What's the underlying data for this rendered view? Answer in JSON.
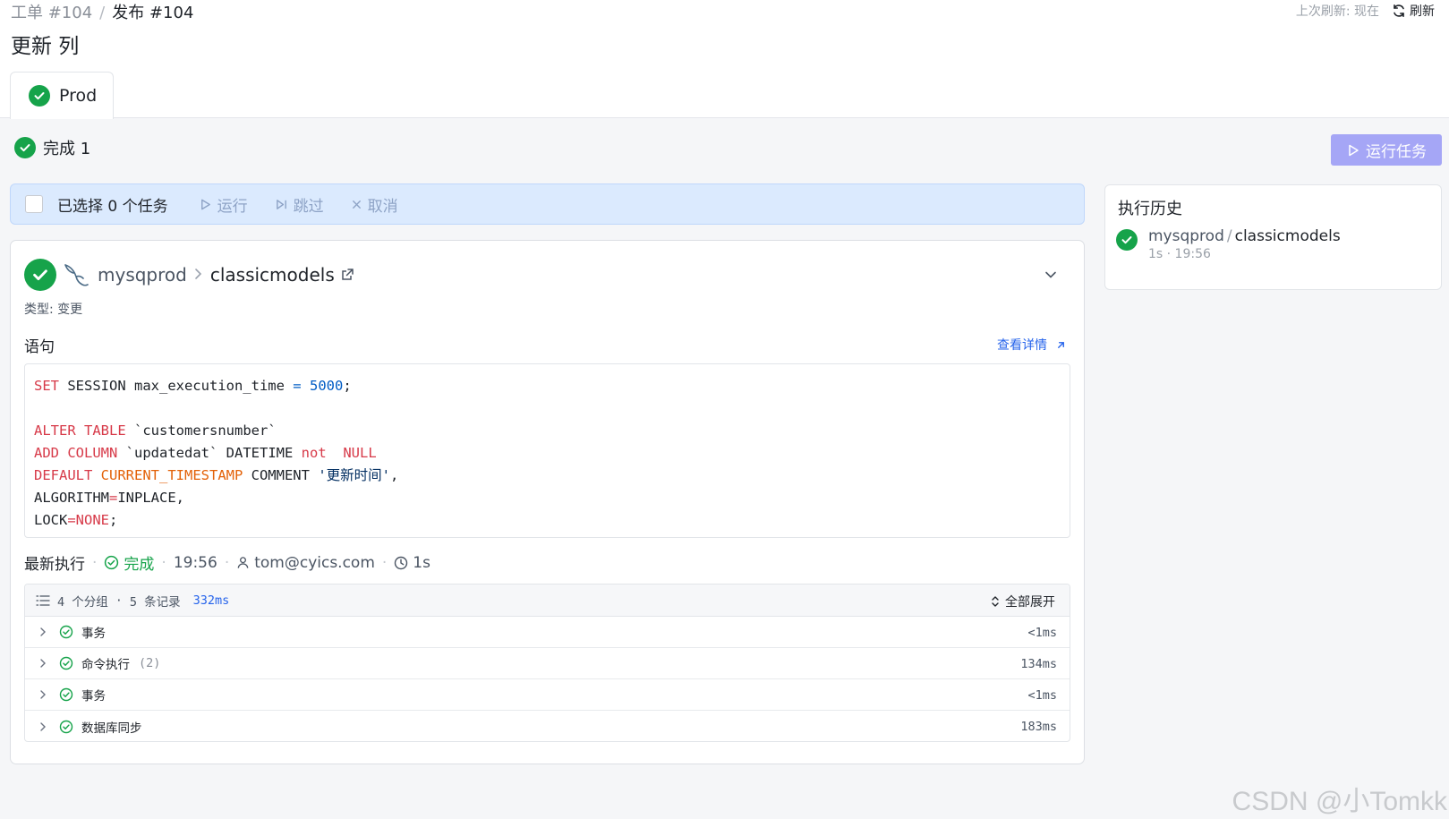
{
  "breadcrumb": {
    "ticket": "工单 #104",
    "separator": "/",
    "release": "发布 #104"
  },
  "refresh": {
    "last_refresh": "上次刷新: 现在",
    "button_label": "刷新"
  },
  "page_title": "更新 列",
  "tabs": [
    {
      "label": "Prod",
      "status": "done"
    }
  ],
  "status": {
    "label": "完成 1"
  },
  "run_task_button": "运行任务",
  "selection_bar": {
    "selected_text": "已选择 0 个任务",
    "actions": {
      "run": "运行",
      "skip": "跳过",
      "cancel": "取消"
    }
  },
  "task": {
    "instance": "mysqprod",
    "database": "classicmodels",
    "type_line": "类型: 变更",
    "statement_label": "语句",
    "detail_link": "查看详情",
    "latest_label": "最新执行",
    "latest_status": "完成",
    "latest_time": "19:56",
    "latest_user": "tom@cyics.com",
    "latest_duration": "1s",
    "groups_summary": {
      "groups": "4 个分组",
      "records": "5 条记录",
      "duration": "332ms",
      "expand_all": "全部展开"
    },
    "groups": [
      {
        "name": "事务",
        "count": "",
        "duration": "<1ms"
      },
      {
        "name": "命令执行",
        "count": "(2)",
        "duration": "134ms"
      },
      {
        "name": "事务",
        "count": "",
        "duration": "<1ms"
      },
      {
        "name": "数据库同步",
        "count": "",
        "duration": "183ms"
      }
    ]
  },
  "history": {
    "title": "执行历史",
    "items": [
      {
        "instance": "mysqprod",
        "separator": "/",
        "database": "classicmodels",
        "meta": "1s · 19:56"
      }
    ]
  },
  "watermark": "CSDN @小Tomkk",
  "colors": {
    "success": "#16a34a",
    "primary": "#a5a6f6",
    "link": "#2563eb",
    "selection_bg": "#dbeafe"
  },
  "icons": [
    "check-circle-icon",
    "refresh-icon",
    "play-icon",
    "skip-icon",
    "close-icon",
    "mysql-icon",
    "external-link-icon",
    "chevron-down-icon",
    "arrow-up-right-icon",
    "user-icon",
    "clock-icon",
    "list-icon",
    "unfold-icon",
    "chevron-right-icon"
  ]
}
